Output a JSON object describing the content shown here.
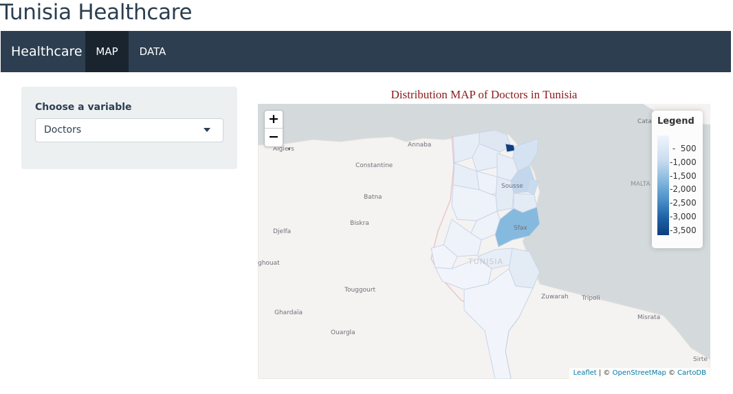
{
  "app": {
    "title": "Tunisia Healthcare"
  },
  "navbar": {
    "brand": "Healthcare",
    "tabs": [
      {
        "label": "MAP",
        "active": true
      },
      {
        "label": "DATA",
        "active": false
      }
    ],
    "background": "#2c3e50"
  },
  "sidebar": {
    "variable_label": "Choose a variable",
    "variable_select": {
      "selected": "Doctors"
    }
  },
  "map": {
    "title": "Distribution MAP of Doctors in Tunisia",
    "zoom_in": "+",
    "zoom_out": "−",
    "legend": {
      "title": "Legend",
      "ticks": [
        "500",
        "1,000",
        "1,500",
        "2,000",
        "2,500",
        "3,000",
        "3,500"
      ],
      "color_low": "#f1f5fb",
      "color_high": "#0b3e7d"
    },
    "cities": {
      "algiers": "Algiers",
      "annaba": "Annaba",
      "constantine": "Constantine",
      "batna": "Batna",
      "biskra": "Biskra",
      "djelfa": "Djelfa",
      "laghouat": "ghouat",
      "touggourt": "Touggourt",
      "ghardaia": "Ghardaïa",
      "ouargla": "Ouargla",
      "sousse": "Sousse",
      "sfax": "Sfax",
      "zuwarah": "Zuwarah",
      "tripoli": "Tripoli",
      "misrata": "Misrata",
      "sirte": "Sirte",
      "malta": "MALTA",
      "catania": "Cata",
      "tunisia": "TUNISIA"
    },
    "attribution": {
      "leaflet": "Leaflet",
      "separator": " | © ",
      "osm": "OpenStreetMap",
      "separator2": " © ",
      "carto": "CartoDB"
    }
  }
}
